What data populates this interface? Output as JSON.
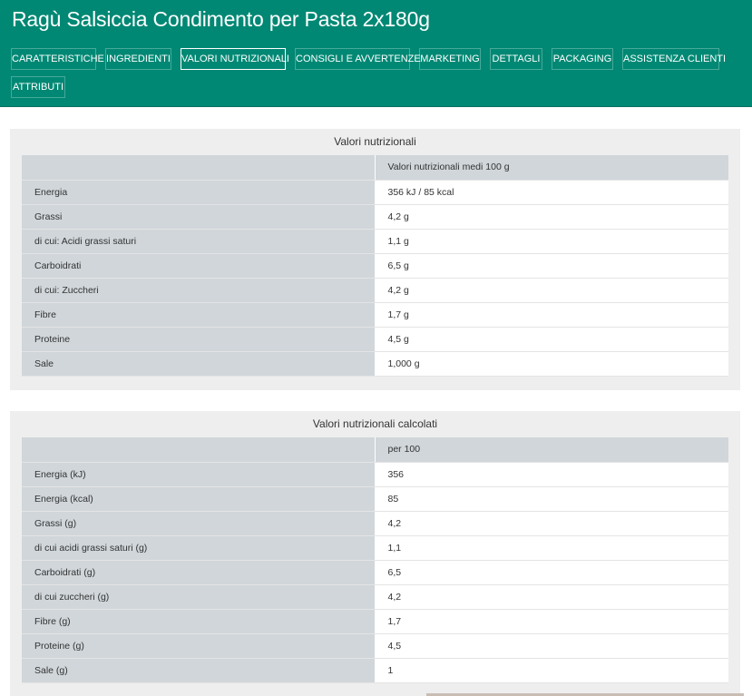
{
  "header": {
    "title": "Ragù Salsiccia Condimento per Pasta 2x180g",
    "tabs": [
      {
        "label": "CARATTERISTICHE",
        "active": false
      },
      {
        "label": "INGREDIENTI",
        "active": false
      },
      {
        "label": "VALORI NUTRIZIONALI",
        "active": true
      },
      {
        "label": "CONSIGLI E AVVERTENZE",
        "active": false
      },
      {
        "label": "MARKETING",
        "active": false
      },
      {
        "label": "DETTAGLI",
        "active": false
      },
      {
        "label": "PACKAGING",
        "active": false
      },
      {
        "label": "ASSISTENZA CLIENTI",
        "active": false
      },
      {
        "label": "ATTRIBUTI",
        "active": false
      }
    ]
  },
  "colors": {
    "header_bg": "#008874",
    "panel_bg": "#eeeeee",
    "label_cell_bg": "#d0d6da",
    "value_cell_bg": "#ffffff"
  },
  "nutrition": {
    "title": "Valori nutrizionali",
    "column_header": "Valori nutrizionali medi 100 g",
    "rows": [
      {
        "label": "Energia",
        "value": "356 kJ / 85 kcal"
      },
      {
        "label": "Grassi",
        "value": "4,2 g"
      },
      {
        "label": "di cui: Acidi grassi saturi",
        "value": "1,1 g"
      },
      {
        "label": "Carboidrati",
        "value": "6,5 g"
      },
      {
        "label": "di cui: Zuccheri",
        "value": "4,2 g"
      },
      {
        "label": "Fibre",
        "value": "1,7 g"
      },
      {
        "label": "Proteine",
        "value": "4,5 g"
      },
      {
        "label": "Sale",
        "value": "1,000 g"
      }
    ]
  },
  "calculated": {
    "title": "Valori nutrizionali calcolati",
    "column_header": "per 100",
    "rows": [
      {
        "label": "Energia (kJ)",
        "value": "356"
      },
      {
        "label": "Energia (kcal)",
        "value": "85"
      },
      {
        "label": "Grassi (g)",
        "value": "4,2"
      },
      {
        "label": "di cui acidi grassi saturi (g)",
        "value": "1,1"
      },
      {
        "label": "Carboidrati (g)",
        "value": "6,5"
      },
      {
        "label": "di cui zuccheri (g)",
        "value": "4,2"
      },
      {
        "label": "Fibre (g)",
        "value": "1,7"
      },
      {
        "label": "Proteine (g)",
        "value": "4,5"
      },
      {
        "label": "Sale (g)",
        "value": "1"
      }
    ]
  }
}
